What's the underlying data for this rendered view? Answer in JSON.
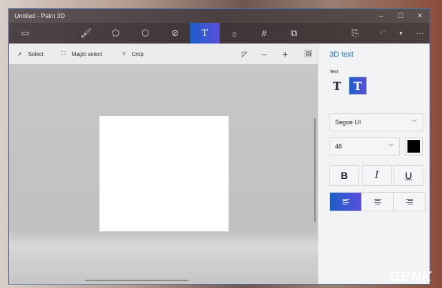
{
  "window": {
    "title": "Untitled - Paint 3D",
    "minimize": "–",
    "maximize": "☐",
    "close": "✕"
  },
  "toolbar": {
    "menu": "▭",
    "brushes": "🖌",
    "shapes2d": "⬠",
    "shapes3d": "⬡",
    "stickers": "⊘",
    "text": "T",
    "effects": "☼",
    "canvas": "#",
    "remix": "⧉",
    "paste": "⎘",
    "undo": "↶",
    "history": "▾",
    "more": "···"
  },
  "subtoolbar": {
    "select": "Select",
    "magic_select": "Magic select",
    "crop": "Crop",
    "view3d": "◸",
    "zoom_out": "–",
    "zoom_in": "+",
    "image": "🖼"
  },
  "panel": {
    "title": "3D text",
    "text_label": "Text",
    "text2d": "T",
    "text3d": "T",
    "font": "Segoe UI",
    "size": "48",
    "color": "#000000",
    "bold": "B",
    "italic": "I",
    "underline": "U"
  },
  "watermark": "GENK"
}
